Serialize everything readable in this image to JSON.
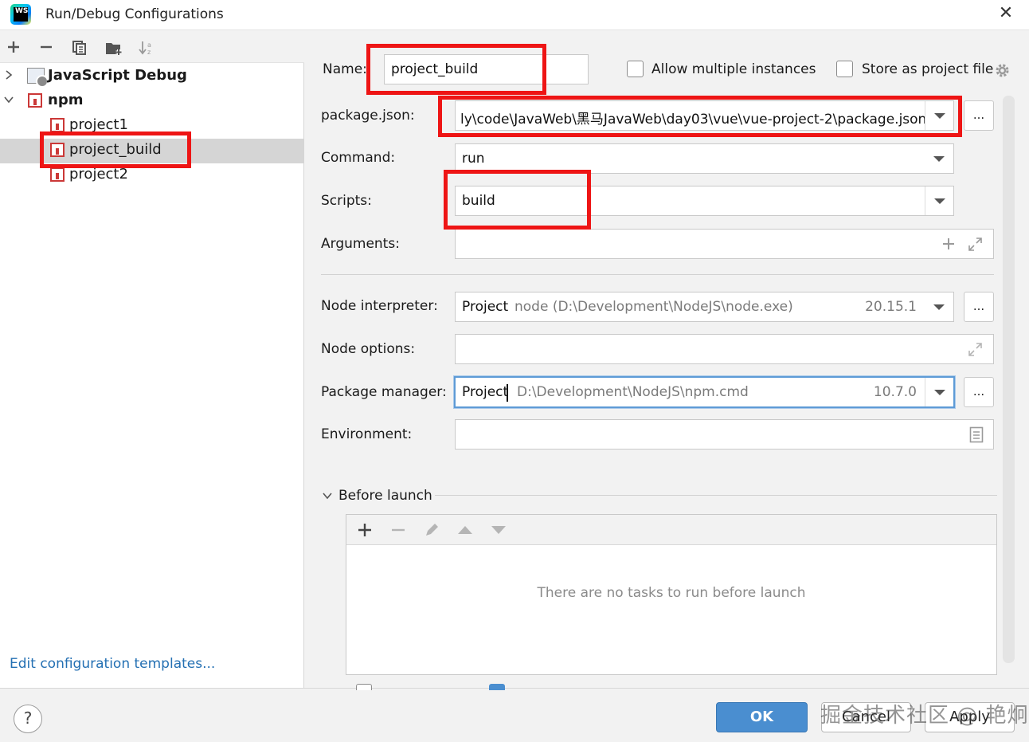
{
  "window": {
    "title": "Run/Debug Configurations",
    "app_icon_text": "WS"
  },
  "tree": {
    "items": [
      {
        "label": "JavaScript Debug",
        "expanded": false
      },
      {
        "label": "npm",
        "expanded": true
      },
      {
        "label": "project1"
      },
      {
        "label": "project_build",
        "selected": true
      },
      {
        "label": "project2"
      }
    ],
    "edit_templates": "Edit configuration templates..."
  },
  "form": {
    "name_label": "Name:",
    "name_value": "project_build",
    "allow_multiple_label": "Allow multiple instances",
    "store_project_label": "Store as project file",
    "package_json_label": "package.json:",
    "package_json_value": "ly\\code\\JavaWeb\\黑马JavaWeb\\day03\\vue\\vue-project-2\\package.json",
    "command_label": "Command:",
    "command_value": "run",
    "scripts_label": "Scripts:",
    "scripts_value": "build",
    "arguments_label": "Arguments:",
    "arguments_value": "",
    "node_interpreter_label": "Node interpreter:",
    "node_interpreter_value": "Project",
    "node_interpreter_path": "node (D:\\Development\\NodeJS\\node.exe)",
    "node_interpreter_version": "20.15.1",
    "node_options_label": "Node options:",
    "node_options_value": "",
    "package_manager_label": "Package manager:",
    "package_manager_value": "Project",
    "package_manager_path": "D:\\Development\\NodeJS\\npm.cmd",
    "package_manager_version": "10.7.0",
    "environment_label": "Environment:",
    "environment_value": "",
    "browse_label": "..."
  },
  "before_launch": {
    "title": "Before launch",
    "empty_message": "There are no tasks to run before launch"
  },
  "buttons": {
    "help": "?",
    "ok": "OK",
    "cancel": "Cancel",
    "apply": "Apply"
  },
  "watermark": "掘金技术社区 @ 艳炯",
  "colors": {
    "highlight_red": "#ee1515",
    "ok_blue": "#4a8ed0",
    "link_blue": "#2470b3",
    "npm_red": "#cb3837"
  }
}
